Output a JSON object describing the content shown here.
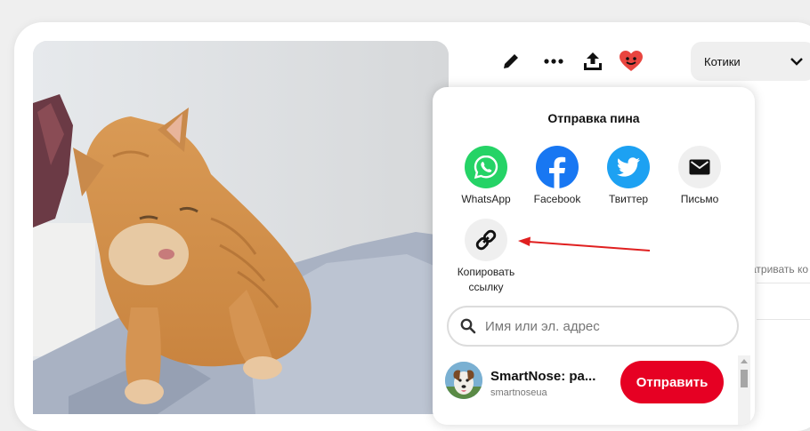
{
  "toolbar": {
    "edit_icon": "pencil-icon",
    "more_icon": "more-horizontal-icon",
    "share_icon": "share-upload-icon",
    "reaction_icon": "heart-face-icon",
    "reaction_color": "#e9453f"
  },
  "board": {
    "selected": "Котики"
  },
  "background": {
    "partial_text": "атривать ко"
  },
  "share": {
    "title": "Отправка пина",
    "options": [
      {
        "label": "WhatsApp",
        "icon": "whatsapp-icon",
        "color": "#25d366"
      },
      {
        "label": "Facebook",
        "icon": "facebook-icon",
        "color": "#1877f2"
      },
      {
        "label": "Твиттер",
        "icon": "twitter-icon",
        "color": "#1da1f2"
      },
      {
        "label": "Письмо",
        "icon": "mail-icon",
        "color": "#efefef"
      }
    ],
    "copy_link": {
      "line1": "Копировать",
      "line2": "ссылку",
      "icon": "link-icon",
      "color": "#efefef"
    },
    "search": {
      "placeholder": "Имя или эл. адрес"
    },
    "contacts": [
      {
        "name": "SmartNose: ра...",
        "handle": "smartnoseua",
        "action": "Отправить"
      }
    ],
    "accent_color": "#e60023"
  }
}
